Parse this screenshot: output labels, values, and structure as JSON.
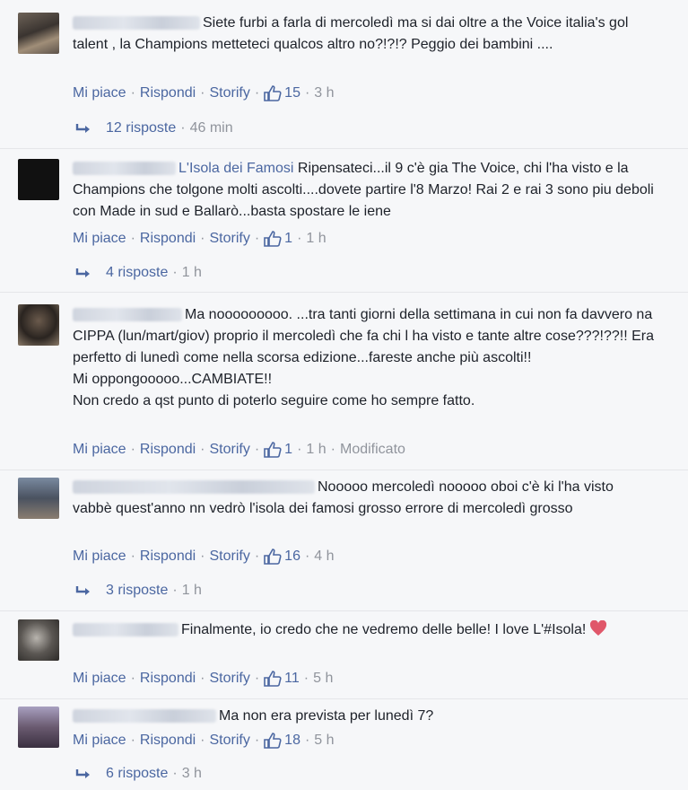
{
  "actions": {
    "like": "Mi piace",
    "reply": "Rispondi",
    "storify": "Storify",
    "dot": "·"
  },
  "colors": {
    "link": "#4b67a1",
    "meta": "#90949c",
    "text": "#1d2129",
    "heart": "#e0576a"
  },
  "icons": {
    "like": "thumbs-up-icon",
    "reply_arrow": "reply-arrow-icon",
    "heart": "heart-emoji-icon"
  },
  "comments": [
    {
      "text": "Siete furbi a farla di mercoledì ma si dai oltre a the Voice italia's gol talent , la Champions metteteci qualcos altro no?!?!? Peggio dei bambini ....",
      "likes": "15",
      "time": "3 h",
      "edited": "",
      "replies": {
        "count": "12 risposte",
        "time": "46 min"
      }
    },
    {
      "text_link": "L'Isola dei Famosi",
      "text": " Ripensateci...il 9 c'è gia The Voice, chi l'ha visto e la Champions che tolgone molti ascolti....dovete partire l'8 Marzo! Rai 2 e rai 3 sono piu deboli con Made in sud e Ballarò...basta spostare le iene",
      "likes": "1",
      "time": "1 h",
      "edited": "",
      "replies": {
        "count": "4 risposte",
        "time": "1 h"
      }
    },
    {
      "text": "Ma nooooooooo. ...tra tanti giorni della settimana in cui non fa davvero na CIPPA (lun/mart/giov) proprio il mercoledì che fa chi l ha visto e tante altre cose???!??!! Era perfetto di lunedì come nella scorsa edizione...fareste anche più ascolti!!",
      "text2": "Mi oppongooooo...CAMBIATE!!",
      "text3": "Non credo a qst punto di poterlo seguire come ho sempre fatto.",
      "likes": "1",
      "time": "1 h",
      "edited": "Modificato"
    },
    {
      "text": "Nooooo mercoledì nooooo oboi c'è ki l'ha visto vabbè quest'anno nn vedrò l'isola dei famosi grosso errore di mercoledì grosso",
      "likes": "16",
      "time": "4 h",
      "edited": "",
      "replies": {
        "count": "3 risposte",
        "time": "1 h"
      }
    },
    {
      "text": "Finalmente, io credo che ne vedremo delle belle! I love L'#Isola!",
      "likes": "11",
      "time": "5 h",
      "edited": ""
    },
    {
      "text": "Ma non era prevista per lunedì 7?",
      "likes": "18",
      "time": "5 h",
      "edited": "",
      "replies": {
        "count": "6 risposte",
        "time": "3 h"
      }
    }
  ]
}
